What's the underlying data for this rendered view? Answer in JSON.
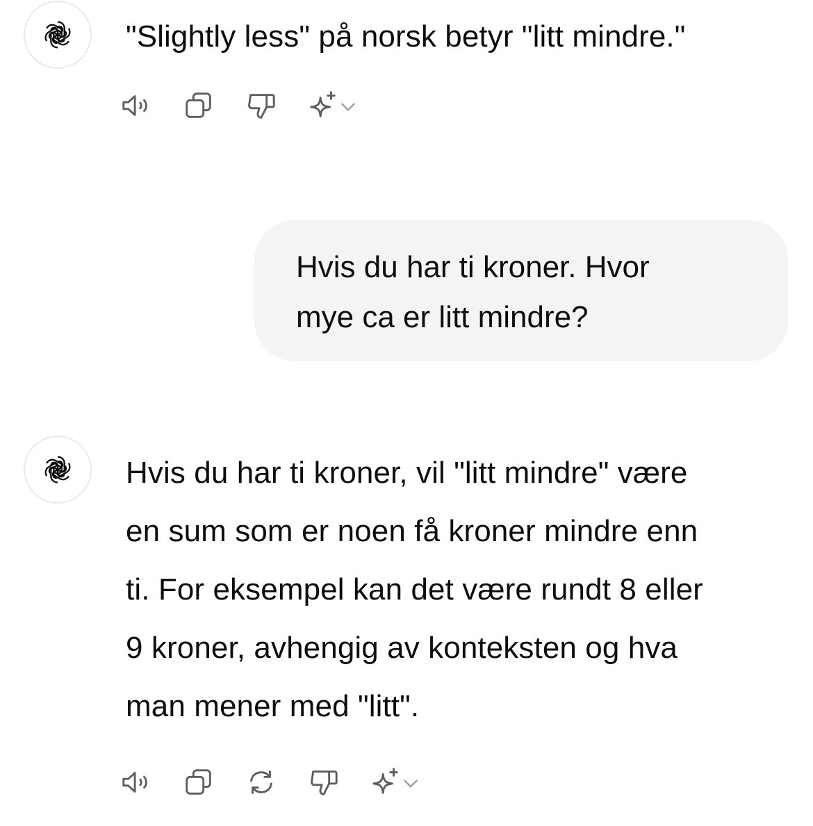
{
  "conversation": {
    "messages": [
      {
        "role": "assistant",
        "avatar_icon": "openai-logo-icon",
        "lines": [
          "\"Slightly less\" på norsk betyr \"litt mindre.\""
        ]
      },
      {
        "role": "user",
        "lines": [
          "Hvis du har ti kroner. Hvor",
          "mye ca er litt mindre?"
        ]
      },
      {
        "role": "assistant",
        "avatar_icon": "openai-logo-icon",
        "lines": [
          "Hvis du har ti kroner, vil \"litt mindre\" være",
          "en sum som er noen få kroner mindre enn",
          "ti. For eksempel kan det være rundt 8 eller",
          "9 kroner, avhengig av konteksten og hva",
          "man mener med \"litt\"."
        ]
      }
    ],
    "action_icons_first": [
      "read-aloud-icon",
      "copy-icon",
      "thumbs-down-icon",
      "sparkle-icon",
      "chevron-down-icon"
    ],
    "action_icons_last": [
      "read-aloud-icon",
      "copy-icon",
      "regenerate-icon",
      "thumbs-down-icon",
      "sparkle-icon",
      "chevron-down-icon"
    ]
  },
  "colors": {
    "background": "#ffffff",
    "text": "#0d0d0d",
    "user_bubble": "#f4f4f4",
    "icon": "#5d5d5d",
    "avatar_border": "#e9e9e9"
  }
}
